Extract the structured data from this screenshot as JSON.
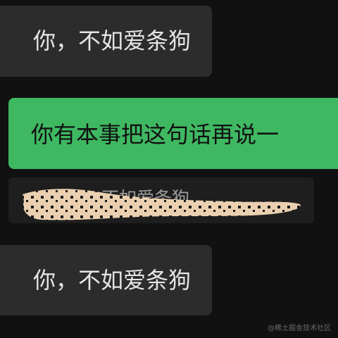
{
  "messages": {
    "incoming_top": "你，不如爱条狗",
    "outgoing": "你有本事把这句话再说一",
    "quote": "…爱你，不如爱条狗",
    "incoming_bottom": "你，不如爱条狗"
  },
  "watermark": "@稀土掘金技术社区",
  "colors": {
    "background": "#111111",
    "incoming_bubble": "#2c2c2c",
    "outgoing_bubble": "#3fb862",
    "quote_bubble": "#1e1e1e",
    "redaction": "#ead0b0"
  }
}
